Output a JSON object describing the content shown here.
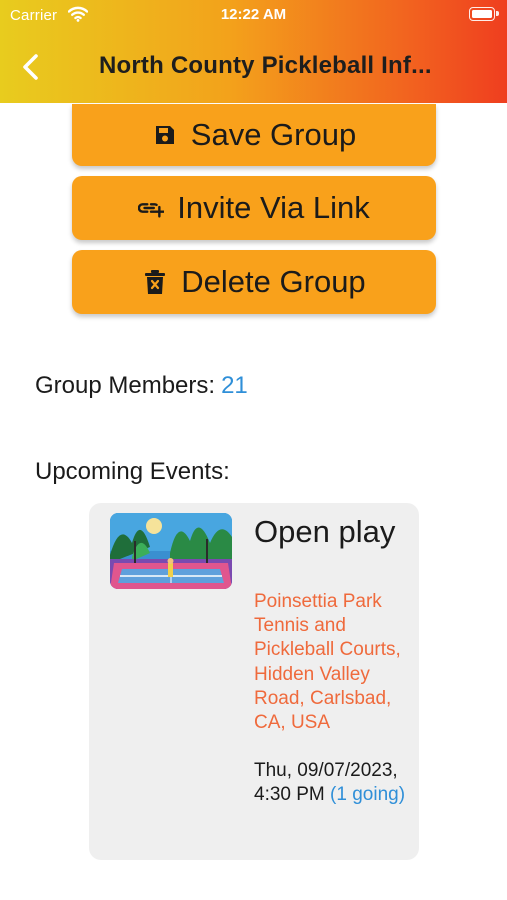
{
  "status_bar": {
    "carrier": "Carrier",
    "time": "12:22 AM"
  },
  "nav": {
    "title": "North County Pickleball  Inf..."
  },
  "actions": {
    "save": {
      "label": "Save Group",
      "icon": "floppy-disk-icon"
    },
    "invite": {
      "label": "Invite Via Link",
      "icon": "link-plus-icon"
    },
    "delete": {
      "label": "Delete Group",
      "icon": "trash-icon"
    }
  },
  "members": {
    "label": "Group Members:",
    "count": "21"
  },
  "events": {
    "heading": "Upcoming Events:",
    "items": [
      {
        "title": "Open play",
        "location": "Poinsettia Park Tennis and Pickleball Courts, Hidden Valley Road, Carlsbad, CA, USA",
        "datetime": "Thu, 09/07/2023, 4:30 PM",
        "going": "(1 going)"
      }
    ]
  },
  "colors": {
    "header_gradient": [
      "#e8cc1e",
      "#f3a21b",
      "#ef3e1f"
    ],
    "button": "#f9a11b",
    "link_blue": "#2f8fd8",
    "location_orange": "#ef6a3c",
    "card_bg": "#efefef"
  }
}
